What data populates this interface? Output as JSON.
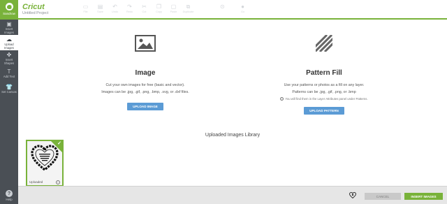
{
  "brand": {
    "name": "Cricut",
    "project": "Untitled Project"
  },
  "user": {
    "name": "Sandrow"
  },
  "sidebar": {
    "items": [
      {
        "label": "Insert\nImages",
        "icon": "image-icon"
      },
      {
        "label": "Upload\nImages",
        "icon": "upload-cloud-icon"
      },
      {
        "label": "Insert\nShapes",
        "icon": "shapes-icon"
      },
      {
        "label": "Add Text",
        "icon": "text-icon"
      },
      {
        "label": "Set Canvas",
        "icon": "shirt-icon"
      }
    ],
    "help": "Help"
  },
  "toolbar": {
    "items": [
      {
        "label": "File",
        "icon": "folder-icon"
      },
      {
        "label": "Save",
        "icon": "save-icon"
      },
      {
        "label": "Undo",
        "icon": "undo-icon"
      },
      {
        "label": "Redo",
        "icon": "redo-icon"
      },
      {
        "label": "Cut",
        "icon": "scissors-icon"
      },
      {
        "label": "Copy",
        "icon": "copy-icon"
      },
      {
        "label": "Paste",
        "icon": "paste-icon"
      },
      {
        "label": "Duplicate",
        "icon": "duplicate-icon"
      }
    ],
    "extra1": {
      "label": "",
      "icon": "circle-dots-icon"
    },
    "extra2": {
      "label": "Go",
      "icon": "go-icon"
    }
  },
  "image_panel": {
    "title": "Image",
    "desc1": "Cut your own images for free (basic and vector).",
    "desc2": "Images can be .jpg, .gif, .png, .bmp, .svg, or .dxf files.",
    "button": "UPLOAD IMAGE"
  },
  "pattern_panel": {
    "title": "Pattern Fill",
    "desc1": "Use your patterns or photos as a fill on any layer.",
    "desc2": "Patterns can be .jpg, .gif, .png, or .bmp",
    "note": "You will find them in the Layer Attributes panel under Patterns.",
    "button": "UPLOAD PATTERN"
  },
  "library": {
    "title": "Uploaded Images Library",
    "card_label": "Uploaded"
  },
  "footer": {
    "cancel": "CANCEL",
    "insert": "INSERT IMAGES"
  },
  "colors": {
    "accent": "#79b23a",
    "sidebar": "#4a4f55",
    "upload_button": "#5b9bd5"
  }
}
